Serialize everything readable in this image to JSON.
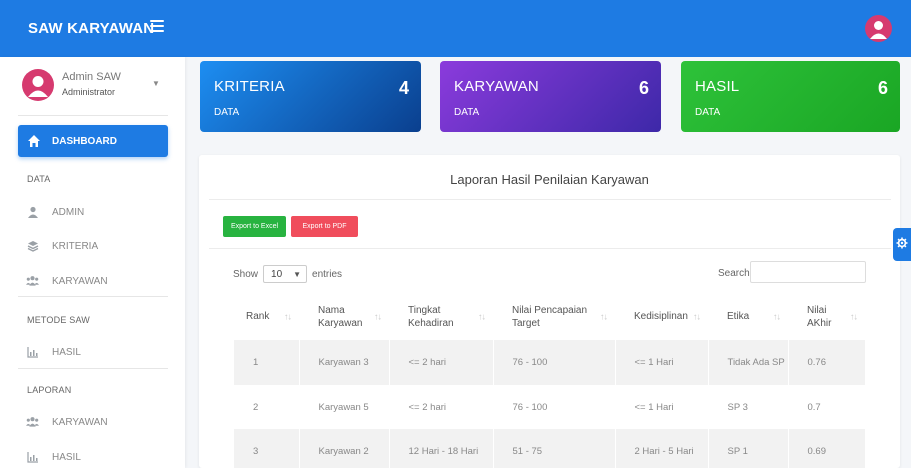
{
  "app": {
    "brand": "SAW KARYAWAN"
  },
  "user": {
    "name": "Admin SAW",
    "role": "Administrator"
  },
  "sidebar": {
    "active": "DASHBOARD",
    "sections": [
      {
        "header": "DATA",
        "items": [
          "ADMIN",
          "KRITERIA",
          "KARYAWAN"
        ]
      },
      {
        "header": "METODE SAW",
        "items": [
          "HASIL"
        ]
      },
      {
        "header": "LAPORAN",
        "items": [
          "KARYAWAN",
          "HASIL"
        ]
      }
    ]
  },
  "cards": [
    {
      "title": "KRITERIA",
      "sub": "DATA",
      "count": "4",
      "color": "#1d8ef2"
    },
    {
      "title": "KARYAWAN",
      "sub": "DATA",
      "count": "6",
      "color": "#6f35c9"
    },
    {
      "title": "HASIL",
      "sub": "DATA",
      "count": "6",
      "color": "#2ec23a"
    }
  ],
  "report": {
    "title": "Laporan Hasil Penilaian Karyawan",
    "export_excel": "Export to Excel",
    "export_pdf": "Export to PDF",
    "show_label": "Show",
    "entries_value": "10",
    "entries_label": "entries",
    "search_label": "Search:",
    "search_value": "",
    "columns": [
      "Rank",
      "Nama Karyawan",
      "Tingkat Kehadiran",
      "Nilai Pencapaian Target",
      "Kedisiplinan",
      "Etika",
      "Nilai AKhir"
    ],
    "rows": [
      [
        "1",
        "Karyawan 3",
        "<= 2 hari",
        "76 - 100",
        "<= 1 Hari",
        "Tidak Ada SP",
        "0.76"
      ],
      [
        "2",
        "Karyawan 5",
        "<= 2 hari",
        "76 - 100",
        "<= 1 Hari",
        "SP 3",
        "0.7"
      ],
      [
        "3",
        "Karyawan 2",
        "12 Hari - 18 Hari",
        "51 - 75",
        "2 Hari - 5 Hari",
        "SP 1",
        "0.69"
      ]
    ]
  },
  "colors": {
    "primary": "#1e7be3",
    "excel": "#28b340",
    "pdf": "#f04d5c",
    "avatar": "#d63a6f"
  }
}
